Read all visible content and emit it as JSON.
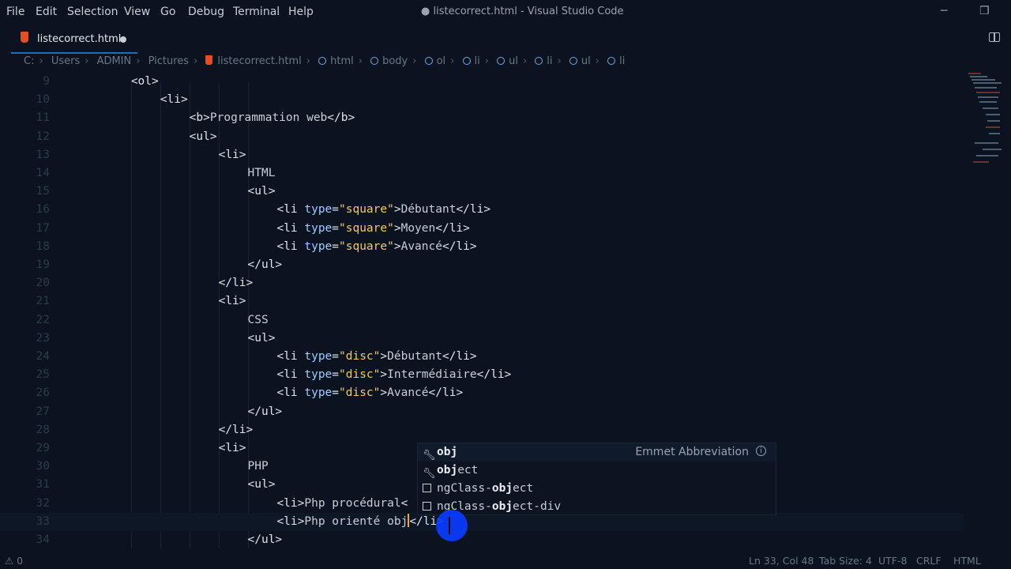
{
  "menu": [
    "File",
    "Edit",
    "Selection",
    "View",
    "Go",
    "Debug",
    "Terminal",
    "Help"
  ],
  "window_title": "● listecorrect.html - Visual Studio Code",
  "window_controls": {
    "minimize": "─",
    "restore": "❐"
  },
  "tab": {
    "label": "listecorrect.html",
    "modified": true
  },
  "breadcrumb": [
    "C:",
    "Users",
    "ADMIN",
    "Pictures",
    "listecorrect.html",
    "html",
    "body",
    "ol",
    "li",
    "ul",
    "li",
    "ul",
    "li"
  ],
  "editor": {
    "lines": [
      {
        "n": "9",
        "indent": 2,
        "parts": [
          [
            "tag",
            "<ol>"
          ]
        ]
      },
      {
        "n": "10",
        "indent": 3,
        "parts": [
          [
            "tag",
            "<li>"
          ]
        ]
      },
      {
        "n": "11",
        "indent": 4,
        "parts": [
          [
            "tag",
            "<b>"
          ],
          [
            "text",
            "Programmation web"
          ],
          [
            "tag",
            "</b>"
          ]
        ]
      },
      {
        "n": "12",
        "indent": 4,
        "parts": [
          [
            "tag",
            "<ul>"
          ]
        ]
      },
      {
        "n": "13",
        "indent": 5,
        "parts": [
          [
            "tag",
            "<li>"
          ]
        ]
      },
      {
        "n": "14",
        "indent": 6,
        "parts": [
          [
            "text",
            "HTML"
          ]
        ]
      },
      {
        "n": "15",
        "indent": 6,
        "parts": [
          [
            "tag",
            "<ul>"
          ]
        ]
      },
      {
        "n": "16",
        "indent": 7,
        "parts": [
          [
            "tag",
            "<li "
          ],
          [
            "attr",
            "type"
          ],
          [
            "tag",
            "="
          ],
          [
            "str",
            "\"square\""
          ],
          [
            "tag",
            ">"
          ],
          [
            "text",
            "Débutant"
          ],
          [
            "tag",
            "</li>"
          ]
        ]
      },
      {
        "n": "17",
        "indent": 7,
        "parts": [
          [
            "tag",
            "<li "
          ],
          [
            "attr",
            "type"
          ],
          [
            "tag",
            "="
          ],
          [
            "str",
            "\"square\""
          ],
          [
            "tag",
            ">"
          ],
          [
            "text",
            "Moyen"
          ],
          [
            "tag",
            "</li>"
          ]
        ]
      },
      {
        "n": "18",
        "indent": 7,
        "parts": [
          [
            "tag",
            "<li "
          ],
          [
            "attr",
            "type"
          ],
          [
            "tag",
            "="
          ],
          [
            "str",
            "\"square\""
          ],
          [
            "tag",
            ">"
          ],
          [
            "text",
            "Avancé"
          ],
          [
            "tag",
            "</li>"
          ]
        ]
      },
      {
        "n": "19",
        "indent": 6,
        "parts": [
          [
            "tag",
            "</ul>"
          ]
        ]
      },
      {
        "n": "20",
        "indent": 5,
        "parts": [
          [
            "tag",
            "</li>"
          ]
        ]
      },
      {
        "n": "21",
        "indent": 5,
        "parts": [
          [
            "tag",
            "<li>"
          ]
        ]
      },
      {
        "n": "22",
        "indent": 6,
        "parts": [
          [
            "text",
            "CSS"
          ]
        ]
      },
      {
        "n": "23",
        "indent": 6,
        "parts": [
          [
            "tag",
            "<ul>"
          ]
        ]
      },
      {
        "n": "24",
        "indent": 7,
        "parts": [
          [
            "tag",
            "<li "
          ],
          [
            "attr",
            "type"
          ],
          [
            "tag",
            "="
          ],
          [
            "str",
            "\"disc\""
          ],
          [
            "tag",
            ">"
          ],
          [
            "text",
            "Débutant"
          ],
          [
            "tag",
            "</li>"
          ]
        ]
      },
      {
        "n": "25",
        "indent": 7,
        "parts": [
          [
            "tag",
            "<li "
          ],
          [
            "attr",
            "type"
          ],
          [
            "tag",
            "="
          ],
          [
            "str",
            "\"disc\""
          ],
          [
            "tag",
            ">"
          ],
          [
            "text",
            "Intermédiaire"
          ],
          [
            "tag",
            "</li>"
          ]
        ]
      },
      {
        "n": "26",
        "indent": 7,
        "parts": [
          [
            "tag",
            "<li "
          ],
          [
            "attr",
            "type"
          ],
          [
            "tag",
            "="
          ],
          [
            "str",
            "\"disc\""
          ],
          [
            "tag",
            ">"
          ],
          [
            "text",
            "Avancé"
          ],
          [
            "tag",
            "</li>"
          ]
        ]
      },
      {
        "n": "27",
        "indent": 6,
        "parts": [
          [
            "tag",
            "</ul>"
          ]
        ]
      },
      {
        "n": "28",
        "indent": 5,
        "parts": [
          [
            "tag",
            "</li>"
          ]
        ]
      },
      {
        "n": "29",
        "indent": 5,
        "parts": [
          [
            "tag",
            "<li>"
          ]
        ]
      },
      {
        "n": "30",
        "indent": 6,
        "parts": [
          [
            "text",
            "PHP"
          ]
        ]
      },
      {
        "n": "31",
        "indent": 6,
        "parts": [
          [
            "tag",
            "<ul>"
          ]
        ]
      },
      {
        "n": "32",
        "indent": 7,
        "parts": [
          [
            "tag",
            "<li>"
          ],
          [
            "text",
            "Php procédural"
          ],
          [
            "tag",
            "<"
          ]
        ]
      },
      {
        "n": "33",
        "indent": 7,
        "parts": [
          [
            "tag",
            "<li>"
          ],
          [
            "text",
            "Php orienté obj"
          ],
          [
            "cursor",
            ""
          ],
          [
            "tag",
            "</li>"
          ]
        ],
        "current": true
      },
      {
        "n": "34",
        "indent": 6,
        "parts": [
          [
            "tag",
            "</ul>"
          ]
        ]
      }
    ]
  },
  "suggest": {
    "items": [
      {
        "icon": "wrench",
        "match": "obj",
        "rest": "",
        "prefix": "",
        "detail": "Emmet Abbreviation",
        "selected": true
      },
      {
        "icon": "wrench",
        "match": "obj",
        "rest": "ect",
        "prefix": "",
        "detail": "",
        "selected": false
      },
      {
        "icon": "snippet",
        "match": "obj",
        "rest": "ect",
        "prefix": "ngClass-",
        "detail": "",
        "selected": false
      },
      {
        "icon": "snippet",
        "match": "obj",
        "rest": "ect-div",
        "prefix": "ngClass-",
        "detail": "",
        "selected": false
      }
    ]
  },
  "status": {
    "problems": "⚠ 0",
    "position": "Ln 33, Col 48",
    "tab_size": "Tab Size: 4",
    "encoding": "UTF-8",
    "eol": "CRLF",
    "language": "HTML"
  }
}
